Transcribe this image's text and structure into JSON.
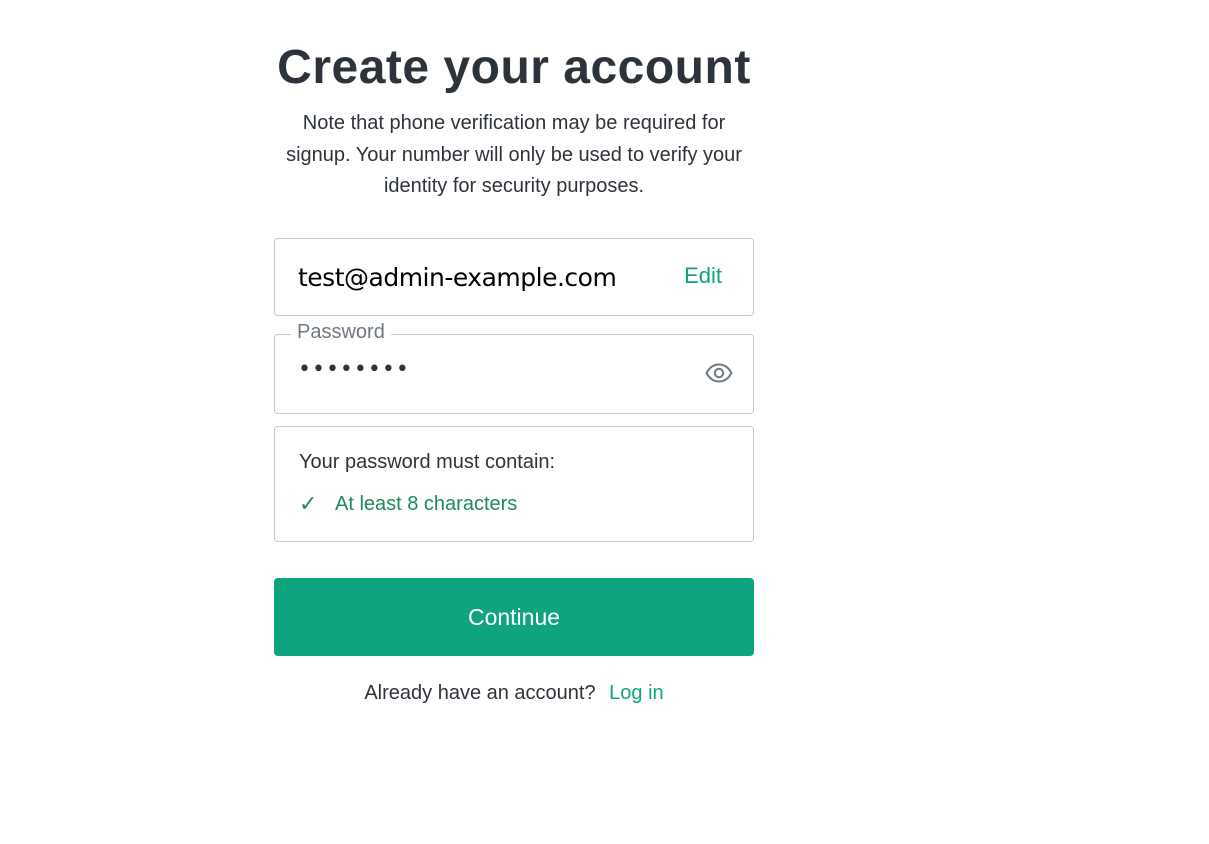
{
  "header": {
    "title": "Create your account",
    "subtitle": "Note that phone verification may be required for signup. Your number will only be used to verify your identity for security purposes."
  },
  "email": {
    "value": "test@admin-example.com",
    "edit_label": "Edit"
  },
  "password": {
    "label": "Password",
    "masked_value": "••••••••",
    "visibility_icon": "eye-icon"
  },
  "requirements": {
    "title": "Your password must contain:",
    "items": [
      {
        "label": "At least 8 characters",
        "met": true,
        "icon": "checkmark-icon"
      }
    ]
  },
  "actions": {
    "continue_label": "Continue"
  },
  "footer": {
    "prompt": "Already have an account?",
    "login_label": "Log in"
  },
  "colors": {
    "accent": "#10a37f",
    "text": "#2d333a",
    "border": "#c2c8d0",
    "success": "#1e8a5c"
  }
}
